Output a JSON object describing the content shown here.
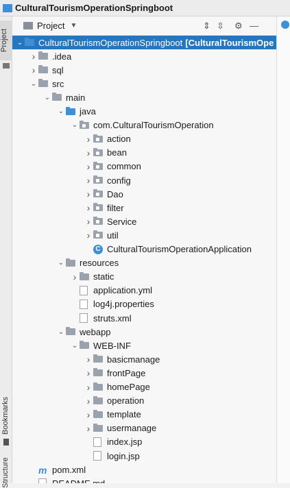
{
  "window": {
    "title": "CulturalTourismOperationSpringboot"
  },
  "left_strip": {
    "tabs": [
      {
        "label": "Project"
      },
      {
        "label": "Bookmarks"
      },
      {
        "label": "Structure"
      }
    ]
  },
  "panel": {
    "title": "Project"
  },
  "tree": [
    {
      "label": "CulturalTourismOperationSpringboot",
      "suffix": "[CulturalTourismOpe",
      "depth": 0,
      "expanded": true,
      "icon": "module-folder-icon",
      "selected": true
    },
    {
      "label": ".idea",
      "depth": 1,
      "expanded": false,
      "icon": "folder-icon"
    },
    {
      "label": "sql",
      "depth": 1,
      "expanded": false,
      "icon": "folder-icon"
    },
    {
      "label": "src",
      "depth": 1,
      "expanded": true,
      "icon": "folder-icon"
    },
    {
      "label": "main",
      "depth": 2,
      "expanded": true,
      "icon": "folder-icon"
    },
    {
      "label": "java",
      "depth": 3,
      "expanded": true,
      "icon": "source-folder-icon"
    },
    {
      "label": "com.CulturalTourismOperation",
      "depth": 4,
      "expanded": true,
      "icon": "package-icon"
    },
    {
      "label": "action",
      "depth": 5,
      "expanded": false,
      "icon": "package-icon"
    },
    {
      "label": "bean",
      "depth": 5,
      "expanded": false,
      "icon": "package-icon"
    },
    {
      "label": "common",
      "depth": 5,
      "expanded": false,
      "icon": "package-icon"
    },
    {
      "label": "config",
      "depth": 5,
      "expanded": false,
      "icon": "package-icon"
    },
    {
      "label": "Dao",
      "depth": 5,
      "expanded": false,
      "icon": "package-icon"
    },
    {
      "label": "filter",
      "depth": 5,
      "expanded": false,
      "icon": "package-icon"
    },
    {
      "label": "Service",
      "depth": 5,
      "expanded": false,
      "icon": "package-icon"
    },
    {
      "label": "util",
      "depth": 5,
      "expanded": false,
      "icon": "package-icon"
    },
    {
      "label": "CulturalTourismOperationApplication",
      "depth": 5,
      "expanded": null,
      "icon": "spring-class-icon"
    },
    {
      "label": "resources",
      "depth": 3,
      "expanded": true,
      "icon": "resources-folder-icon"
    },
    {
      "label": "static",
      "depth": 4,
      "expanded": false,
      "icon": "folder-icon"
    },
    {
      "label": "application.yml",
      "depth": 4,
      "expanded": null,
      "icon": "yml-file-icon"
    },
    {
      "label": "log4j.properties",
      "depth": 4,
      "expanded": null,
      "icon": "properties-file-icon"
    },
    {
      "label": "struts.xml",
      "depth": 4,
      "expanded": null,
      "icon": "xml-file-icon"
    },
    {
      "label": "webapp",
      "depth": 3,
      "expanded": true,
      "icon": "folder-icon"
    },
    {
      "label": "WEB-INF",
      "depth": 4,
      "expanded": true,
      "icon": "folder-icon"
    },
    {
      "label": "basicmanage",
      "depth": 5,
      "expanded": false,
      "icon": "folder-icon"
    },
    {
      "label": "frontPage",
      "depth": 5,
      "expanded": false,
      "icon": "folder-icon"
    },
    {
      "label": "homePage",
      "depth": 5,
      "expanded": false,
      "icon": "folder-icon"
    },
    {
      "label": "operation",
      "depth": 5,
      "expanded": false,
      "icon": "folder-icon"
    },
    {
      "label": "template",
      "depth": 5,
      "expanded": false,
      "icon": "folder-icon"
    },
    {
      "label": "usermanage",
      "depth": 5,
      "expanded": false,
      "icon": "folder-icon"
    },
    {
      "label": "index.jsp",
      "depth": 5,
      "expanded": null,
      "icon": "jsp-file-icon"
    },
    {
      "label": "login.jsp",
      "depth": 5,
      "expanded": null,
      "icon": "jsp-file-icon"
    },
    {
      "label": "pom.xml",
      "depth": 1,
      "expanded": null,
      "icon": "maven-file-icon"
    },
    {
      "label": "README.md",
      "depth": 1,
      "expanded": null,
      "icon": "markdown-file-icon"
    }
  ],
  "colors": {
    "selection": "#2675bf",
    "folder": "#9aa3ad",
    "source": "#3d8fd6"
  }
}
